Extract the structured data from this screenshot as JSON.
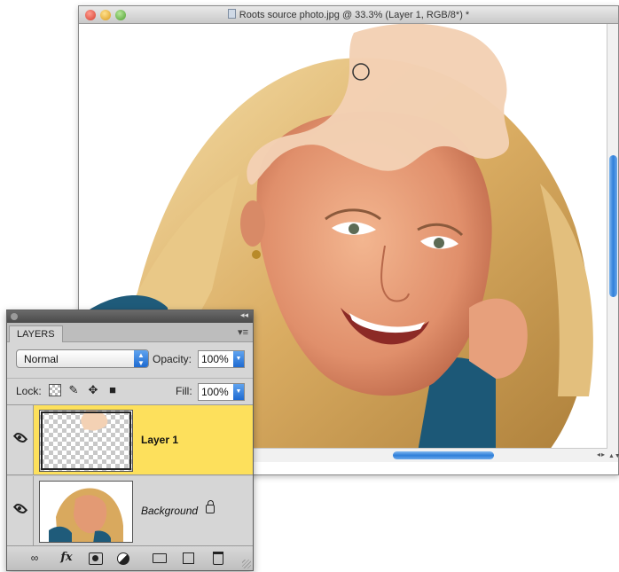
{
  "document_window": {
    "title": "Roots source photo.jpg @ 33.3% (Layer 1, RGB/8*) *",
    "scroll_arrows_vertical": "▲▼",
    "scroll_arrows_horizontal": "◂▸"
  },
  "layers_panel": {
    "collapse_glyph": "◂◂",
    "tab_label": "LAYERS",
    "menu_glyph": "▾≡",
    "blend_mode": "Normal",
    "opacity_label": "Opacity:",
    "opacity_value": "100%",
    "lock_label": "Lock:",
    "fill_label": "Fill:",
    "fill_value": "100%",
    "layers": [
      {
        "name": "Layer 1",
        "selected": true,
        "visible": true
      },
      {
        "name": "Background",
        "selected": false,
        "visible": true,
        "locked": true
      }
    ],
    "footer_icons": [
      "link-icon",
      "fx-icon",
      "mask-icon",
      "adjust-icon",
      "group-icon",
      "new-layer-icon",
      "trash-icon"
    ],
    "fx_label": "fx"
  },
  "colors": {
    "selected_layer": "#fde05c",
    "accent_blue": "#2f7fd9",
    "paint_color": "#f3d1b4"
  }
}
